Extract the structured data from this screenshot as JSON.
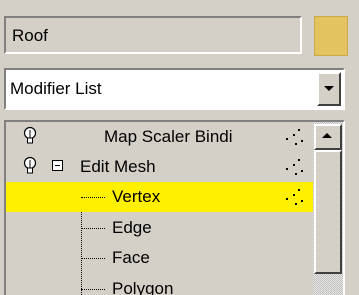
{
  "object": {
    "name": "Roof",
    "color": "#e2c35f"
  },
  "modifier_list": {
    "selected": "Modifier List"
  },
  "stack": {
    "items": [
      {
        "label": "Map Scaler Bindi",
        "level": 0,
        "icon": "lightbulb-icon"
      },
      {
        "label": "Edit Mesh",
        "level": 0,
        "icon": "lightbulb-icon",
        "expanded": true
      },
      {
        "label": "Vertex",
        "level": 1,
        "selected": true
      },
      {
        "label": "Edge",
        "level": 1
      },
      {
        "label": "Face",
        "level": 1
      },
      {
        "label": "Polygon",
        "level": 1
      }
    ],
    "selection_color": "#ffef00"
  }
}
